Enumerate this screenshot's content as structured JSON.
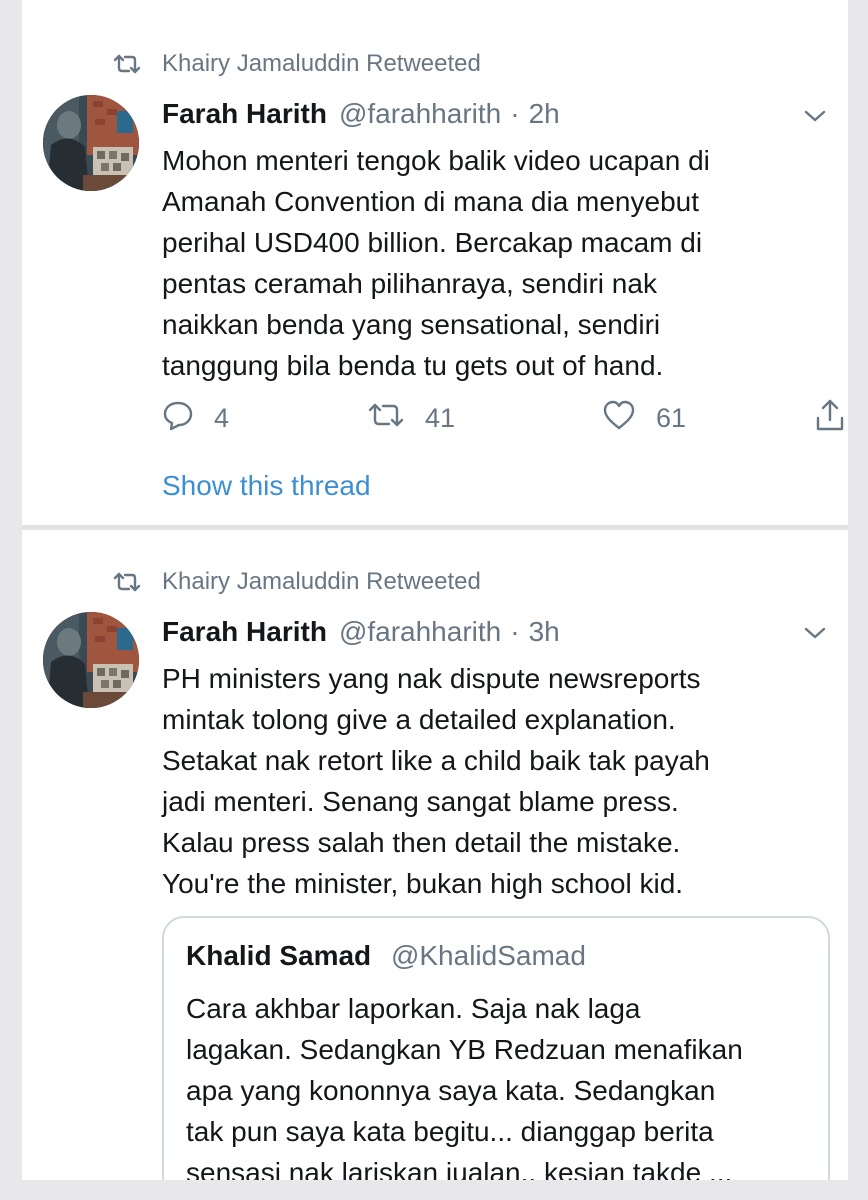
{
  "tweets": [
    {
      "retweet_label": "Khairy Jamaluddin Retweeted",
      "name": "Farah Harith",
      "handle": "@farahharith",
      "separator": "·",
      "time": "2h",
      "text_lines": [
        "Mohon menteri tengok balik video ucapan di",
        "Amanah Convention di mana dia menyebut",
        "perihal USD400 billion. Bercakap macam di",
        "pentas ceramah pilihanraya, sendiri nak",
        "naikkan benda yang sensational, sendiri",
        "tanggung bila benda tu gets out of hand."
      ],
      "replies": "4",
      "retweets": "41",
      "likes": "61",
      "show_thread": "Show this thread"
    },
    {
      "retweet_label": "Khairy Jamaluddin Retweeted",
      "name": "Farah Harith",
      "handle": "@farahharith",
      "separator": "·",
      "time": "3h",
      "text_lines": [
        "PH ministers yang nak dispute newsreports",
        "mintak tolong give a detailed explanation.",
        "Setakat nak retort like a child baik tak payah",
        "jadi menteri. Senang sangat blame press.",
        "Kalau press salah then detail the mistake.",
        "You're the minister, bukan high school kid."
      ],
      "quote": {
        "name": "Khalid Samad",
        "handle": "@KhalidSamad",
        "text_lines": [
          "Cara akhbar laporkan. Saja nak laga",
          "lagakan. Sedangkan YB Redzuan menafikan",
          "apa yang kononnya saya kata. Sedangkan",
          "tak pun saya kata begitu... dianggap berita",
          "sensasi nak lariskan jualan.. kesian takde ..."
        ]
      }
    }
  ],
  "colors": {
    "text": "#14171a",
    "secondary": "#687684",
    "link": "#3d8fd3",
    "background": "#ffffff",
    "outer": "#e8e8ea"
  },
  "icons": [
    "retweet-icon",
    "avatar",
    "chevron-down-icon",
    "reply-icon",
    "like-icon",
    "share-icon"
  ]
}
